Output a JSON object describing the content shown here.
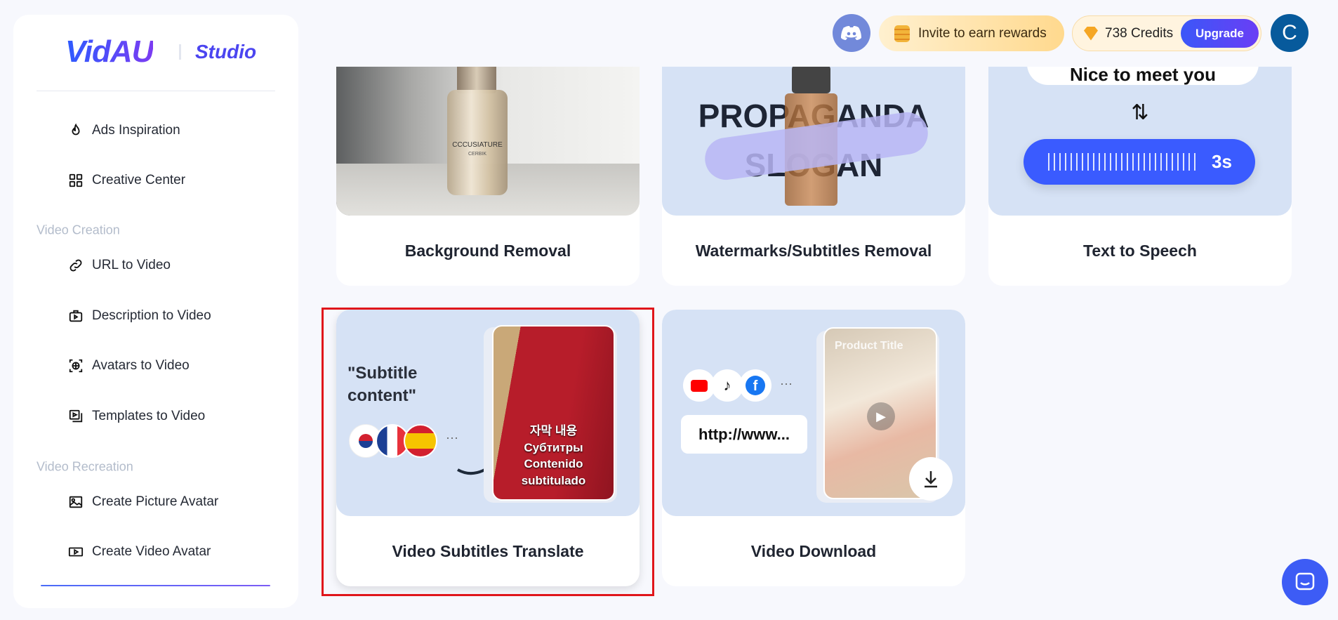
{
  "brand": {
    "logo": "VidAU",
    "product": "Studio"
  },
  "sidebar": {
    "items": [
      {
        "label": "Ads Inspiration",
        "icon": "flame-icon"
      },
      {
        "label": "Creative Center",
        "icon": "grid-icon"
      }
    ],
    "sections": [
      {
        "title": "Video Creation",
        "items": [
          {
            "label": "URL to Video",
            "icon": "link-icon"
          },
          {
            "label": "Description to Video",
            "icon": "video-bag-icon"
          },
          {
            "label": "Avatars to Video",
            "icon": "avatar-scan-icon"
          },
          {
            "label": "Templates to Video",
            "icon": "template-icon"
          }
        ]
      },
      {
        "title": "Video Recreation",
        "items": [
          {
            "label": "Create Picture Avatar",
            "icon": "image-icon"
          },
          {
            "label": "Create Video Avatar",
            "icon": "video-icon"
          }
        ]
      }
    ]
  },
  "header": {
    "invite": "Invite to earn rewards",
    "credits": "738 Credits",
    "upgrade": "Upgrade",
    "avatar_initial": "C"
  },
  "cards": [
    {
      "title": "Background Removal",
      "art": {
        "label": "CCCUSIATURE",
        "sub": "CERBIK"
      }
    },
    {
      "title": "Watermarks/Subtitles Removal",
      "art": {
        "line1": "PROPAGANDA",
        "line2": "SLOGAN"
      }
    },
    {
      "title": "Text to Speech",
      "art": {
        "bubble": "Nice to meet you",
        "swap": "⇅",
        "duration": "3s"
      }
    },
    {
      "title": "Video Subtitles Translate",
      "highlighted": true,
      "art": {
        "quote": "\"Subtitle content\"",
        "more": "···",
        "subs": [
          "자막 내용",
          "Субтитры",
          "Contenido",
          "subtitulado"
        ]
      }
    },
    {
      "title": "Video Download",
      "art": {
        "more": "···",
        "url": "http://www...",
        "product": "Product Title"
      }
    }
  ],
  "colors": {
    "accent": "#3b57f8",
    "highlight": "#e0161b",
    "card_image_bg": "#d6e2f5"
  }
}
